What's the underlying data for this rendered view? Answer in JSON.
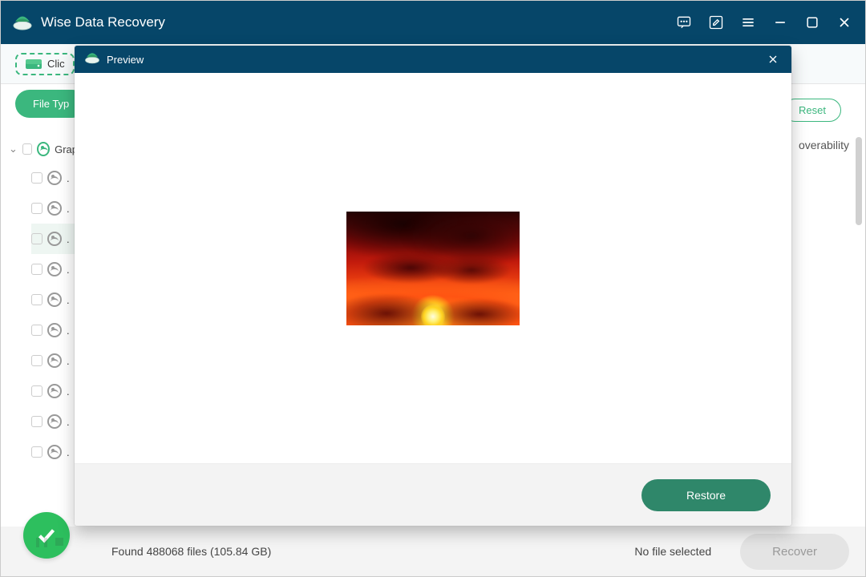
{
  "titlebar": {
    "title": "Wise Data Recovery"
  },
  "toolbar": {
    "click_label": "Clic"
  },
  "filter": {
    "file_type_label": "File Typ",
    "reset_label": "Reset"
  },
  "columns": {
    "recoverability": "overability"
  },
  "tree": {
    "parent_label": "Grap",
    "child_placeholder": "."
  },
  "status": {
    "found": "Found 488068 files (105.84 GB)",
    "no_file": "No file selected",
    "recover_label": "Recover"
  },
  "modal": {
    "title": "Preview",
    "restore_label": "Restore"
  }
}
